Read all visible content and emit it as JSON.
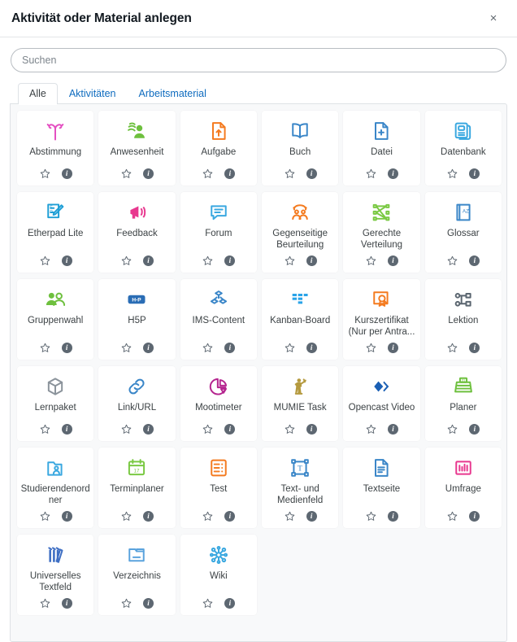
{
  "dialog": {
    "title": "Aktivität oder Material anlegen",
    "close_label": "×",
    "close_icon": "close-icon"
  },
  "search": {
    "placeholder": "Suchen",
    "value": "",
    "icon": "search-icon"
  },
  "tabs": [
    {
      "label": "Alle",
      "active": true
    },
    {
      "label": "Aktivitäten",
      "active": false
    },
    {
      "label": "Arbeitsmaterial",
      "active": false
    }
  ],
  "card_actions": {
    "star_icon": "star-outline-icon",
    "star_label": "☆",
    "info_icon": "info-icon",
    "info_label": "i"
  },
  "colors": {
    "accent": "#0f6cbf",
    "panel_bg": "#f8f9fa",
    "border": "#dee2e6",
    "text": "#3c4245",
    "info_badge": "#5d6771"
  },
  "items": [
    {
      "label": "Abstimmung",
      "icon": "choice-icon",
      "color": "#e44ec1"
    },
    {
      "label": "Anwesenheit",
      "icon": "attendance-icon",
      "color": "#6ec03e"
    },
    {
      "label": "Aufgabe",
      "icon": "assignment-icon",
      "color": "#f47b20"
    },
    {
      "label": "Buch",
      "icon": "book-icon",
      "color": "#3a86c8"
    },
    {
      "label": "Datei",
      "icon": "file-plus-icon",
      "color": "#3a86c8"
    },
    {
      "label": "Datenbank",
      "icon": "database-icon",
      "color": "#3aa8e0"
    },
    {
      "label": "Etherpad Lite",
      "icon": "etherpad-icon",
      "color": "#1f9fd6"
    },
    {
      "label": "Feedback",
      "icon": "megaphone-icon",
      "color": "#e8388f"
    },
    {
      "label": "Forum",
      "icon": "forum-icon",
      "color": "#3aa8e0"
    },
    {
      "label": "Gegenseitige Beurteilung",
      "icon": "workshop-icon",
      "color": "#f47b20"
    },
    {
      "label": "Gerechte Verteilung",
      "icon": "fair-allocation-icon",
      "color": "#7ac943"
    },
    {
      "label": "Glossar",
      "icon": "glossary-icon",
      "color": "#3a86c8"
    },
    {
      "label": "Gruppenwahl",
      "icon": "group-choice-icon",
      "color": "#6ec03e"
    },
    {
      "label": "H5P",
      "icon": "h5p-icon",
      "color": "#2a6db5"
    },
    {
      "label": "IMS-Content",
      "icon": "ims-content-icon",
      "color": "#3a86c8"
    },
    {
      "label": "Kanban-Board",
      "icon": "kanban-icon",
      "color": "#29a3e8"
    },
    {
      "label": "Kurszertifikat (Nur per Antra...",
      "icon": "certificate-icon",
      "color": "#f47b20"
    },
    {
      "label": "Lektion",
      "icon": "lesson-icon",
      "color": "#5b6670"
    },
    {
      "label": "Lernpaket",
      "icon": "scorm-package-icon",
      "color": "#8b939b"
    },
    {
      "label": "Link/URL",
      "icon": "link-icon",
      "color": "#3a86c8"
    },
    {
      "label": "Mootimeter",
      "icon": "mootimeter-icon",
      "color": "#b5258f"
    },
    {
      "label": "MUMIE Task",
      "icon": "mumie-icon",
      "color": "#b59a3f"
    },
    {
      "label": "Opencast Video",
      "icon": "opencast-icon",
      "color": "#1a5fb4"
    },
    {
      "label": "Planer",
      "icon": "scheduler-icon",
      "color": "#6ec03e"
    },
    {
      "label": "Studierendenordner",
      "icon": "student-folder-icon",
      "color": "#3aa8e0"
    },
    {
      "label": "Terminplaner",
      "icon": "calendar-icon",
      "color": "#7ac943"
    },
    {
      "label": "Test",
      "icon": "quiz-icon",
      "color": "#f47b20"
    },
    {
      "label": "Text- und Medienfeld",
      "icon": "text-media-icon",
      "color": "#3a86c8"
    },
    {
      "label": "Textseite",
      "icon": "page-icon",
      "color": "#3a86c8"
    },
    {
      "label": "Umfrage",
      "icon": "survey-icon",
      "color": "#e8388f"
    },
    {
      "label": "Universelles Textfeld",
      "icon": "universal-textfield-icon",
      "color": "#3f6fc4"
    },
    {
      "label": "Verzeichnis",
      "icon": "folder-icon",
      "color": "#5aa3dd"
    },
    {
      "label": "Wiki",
      "icon": "wiki-icon",
      "color": "#3aa8e0"
    }
  ]
}
